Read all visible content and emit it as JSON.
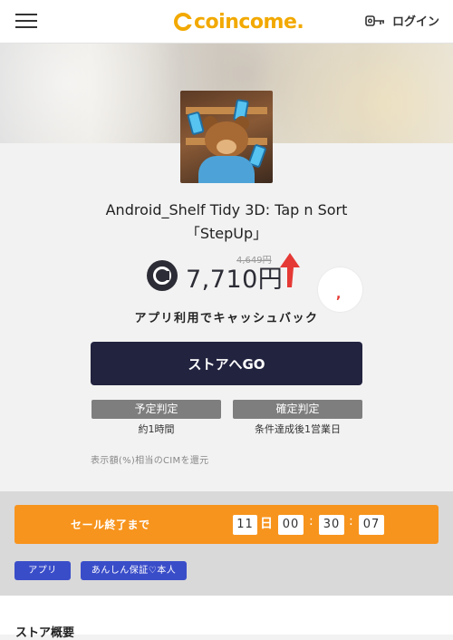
{
  "header": {
    "logo_text": "coincome.",
    "login_label": "ログイン"
  },
  "app": {
    "title_line1": "Android_Shelf Tidy 3D: Tap n Sort",
    "title_line2": "「StepUp」",
    "old_price": "4,649円",
    "new_price": "7,710円",
    "cashback_text": "アプリ利用でキャッシュバック",
    "go_button": "ストアへGO",
    "favorite_mark": ","
  },
  "judgement": {
    "scheduled_label": "予定判定",
    "scheduled_value": "約1時間",
    "confirmed_label": "確定判定",
    "confirmed_value": "条件達成後1営業日"
  },
  "cim_note": "表示額(%)相当のCIMを還元",
  "sale": {
    "label": "セール終了まで",
    "days": "11",
    "day_unit": "日",
    "hours": "00",
    "minutes": "30",
    "seconds": "07",
    "separator": ":"
  },
  "tags": [
    "アプリ",
    "あんしん保証♡本人"
  ],
  "overview_title": "ストア概要",
  "colors": {
    "accent_orange": "#f7941d",
    "brand_yellow": "#f2a900",
    "button_navy": "#22233f",
    "tag_blue": "#3a4dc9",
    "arrow_red": "#e53935"
  }
}
